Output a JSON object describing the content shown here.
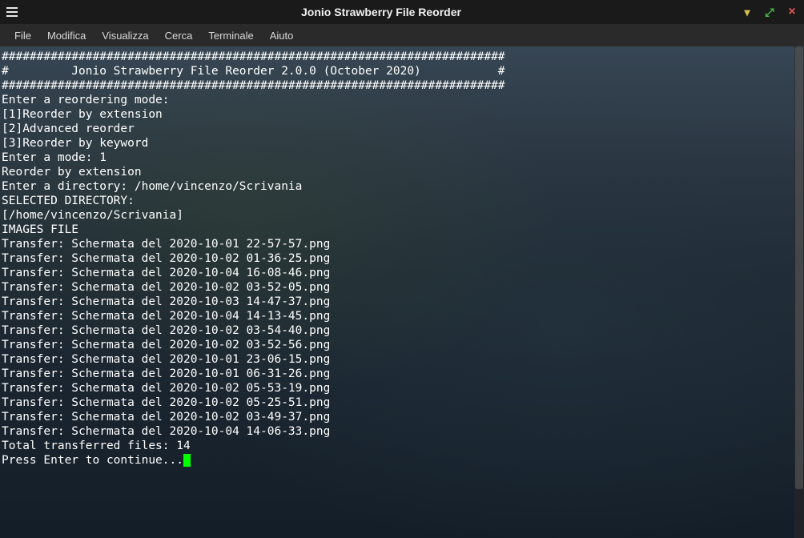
{
  "window": {
    "title": "Jonio Strawberry File Reorder"
  },
  "menubar": {
    "items": [
      {
        "label": "File"
      },
      {
        "label": "Modifica"
      },
      {
        "label": "Visualizza"
      },
      {
        "label": "Cerca"
      },
      {
        "label": "Terminale"
      },
      {
        "label": "Aiuto"
      }
    ]
  },
  "terminal": {
    "lines": [
      "########################################################################",
      "#         Jonio Strawberry File Reorder 2.0.0 (October 2020)           #",
      "########################################################################",
      "Enter a reordering mode:",
      "[1]Reorder by extension",
      "[2]Advanced reorder",
      "[3]Reorder by keyword",
      "Enter a mode: 1",
      "Reorder by extension",
      "Enter a directory: /home/vincenzo/Scrivania",
      "SELECTED DIRECTORY:",
      "[/home/vincenzo/Scrivania]",
      "IMAGES FILE",
      "Transfer: Schermata del 2020-10-01 22-57-57.png",
      "Transfer: Schermata del 2020-10-02 01-36-25.png",
      "Transfer: Schermata del 2020-10-04 16-08-46.png",
      "Transfer: Schermata del 2020-10-02 03-52-05.png",
      "Transfer: Schermata del 2020-10-03 14-47-37.png",
      "Transfer: Schermata del 2020-10-04 14-13-45.png",
      "Transfer: Schermata del 2020-10-02 03-54-40.png",
      "Transfer: Schermata del 2020-10-02 03-52-56.png",
      "Transfer: Schermata del 2020-10-01 23-06-15.png",
      "Transfer: Schermata del 2020-10-01 06-31-26.png",
      "Transfer: Schermata del 2020-10-02 05-53-19.png",
      "Transfer: Schermata del 2020-10-02 05-25-51.png",
      "Transfer: Schermata del 2020-10-02 03-49-37.png",
      "Transfer: Schermata del 2020-10-04 14-06-33.png",
      "Total transferred files: 14",
      "Press Enter to continue..."
    ]
  }
}
